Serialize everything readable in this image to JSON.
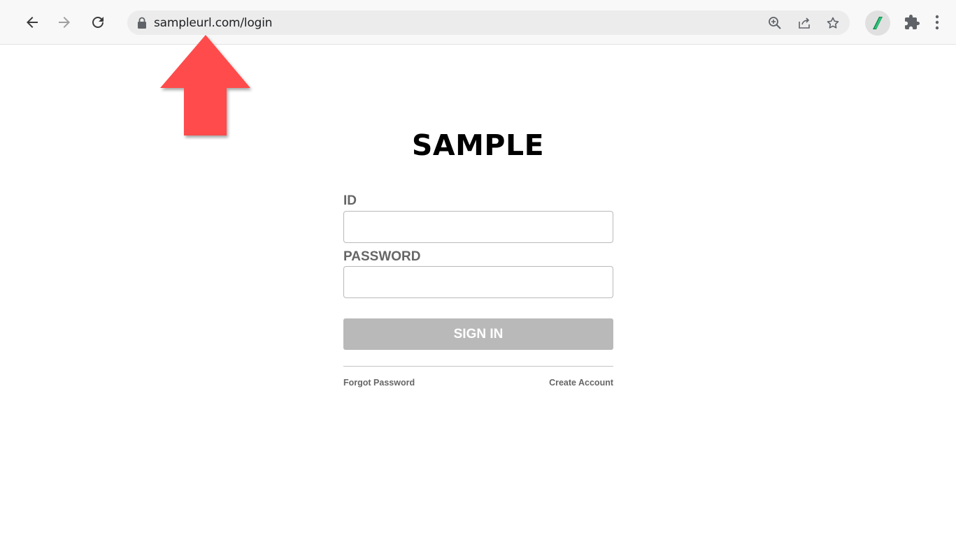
{
  "browser": {
    "url": "sampleurl.com/login",
    "icons": {
      "back": "arrow-left-icon",
      "forward": "arrow-right-icon",
      "reload": "reload-icon",
      "lock": "lock-icon",
      "zoom": "zoom-icon",
      "share": "share-icon",
      "bookmark": "star-icon",
      "extension": "puzzle-icon",
      "menu": "more-vertical-icon"
    }
  },
  "annotation": {
    "arrow_color": "#ff4b4b"
  },
  "login": {
    "brand": "SAMPLE",
    "id_label": "ID",
    "id_value": "",
    "password_label": "PASSWORD",
    "password_value": "",
    "signin_label": "SIGN IN",
    "forgot_password": "Forgot Password",
    "create_account": "Create Account"
  },
  "colors": {
    "button_disabled": "#b9b9b9",
    "label_gray": "#666666"
  }
}
